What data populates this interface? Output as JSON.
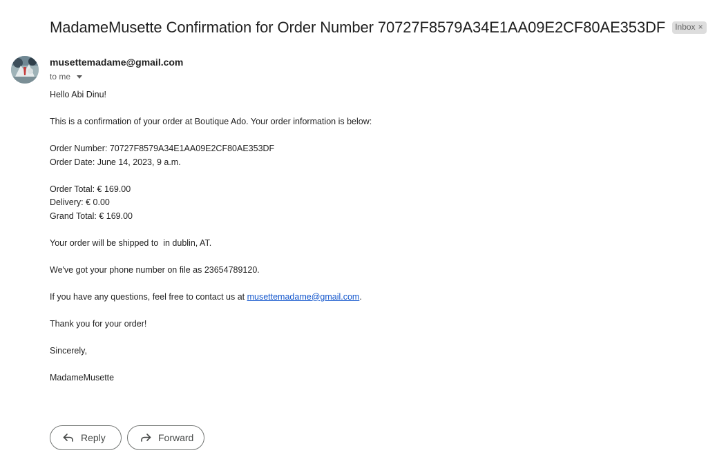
{
  "email": {
    "subject": "MadameMusette Confirmation for Order Number 70727F8579A34E1AA09E2CF80AE353DF",
    "label": "Inbox",
    "label_remove": "×",
    "sender": "musettemadame@gmail.com",
    "recipient": "to me",
    "body": {
      "greeting": "Hello Abi Dinu!",
      "intro": "This is a confirmation of your order at Boutique Ado. Your order information is below:",
      "order_number": "Order Number: 70727F8579A34E1AA09E2CF80AE353DF",
      "order_date": "Order Date: June 14, 2023, 9 a.m.",
      "order_total": "Order Total: € 169.00",
      "delivery": "Delivery: € 0.00",
      "grand_total": "Grand Total: € 169.00",
      "shipping": "Your order will be shipped to  in dublin, AT.",
      "phone": "We've got your phone number on file as 23654789120.",
      "contact_prefix": "If you have any questions, feel free to contact us at ",
      "contact_email": "musettemadame@gmail.com",
      "contact_suffix": ".",
      "thanks": "Thank you for your order!",
      "closing": "Sincerely,",
      "signature": "MadameMusette"
    }
  },
  "actions": {
    "reply_label": "Reply",
    "forward_label": "Forward"
  },
  "icons": {
    "reply": "reply-icon",
    "forward": "forward-icon",
    "caret": "chevron-down-icon",
    "avatar": "avatar"
  },
  "colors": {
    "link": "#1155cc",
    "chip_bg": "#dddddd",
    "button_border": "#747775"
  }
}
